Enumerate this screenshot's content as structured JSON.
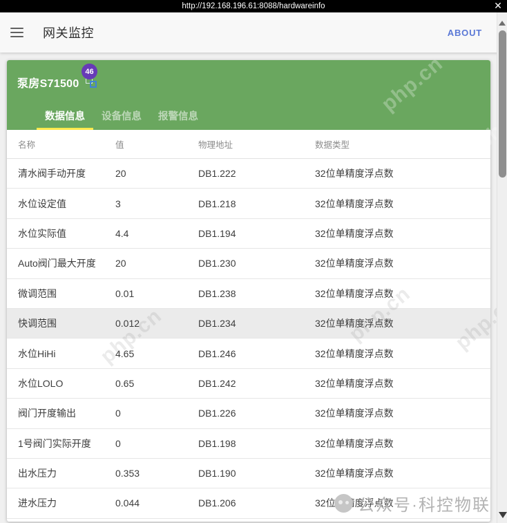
{
  "url_bar": {
    "url": "http://192.168.196.61:8088/hardwareinfo",
    "close_glyph": "✕"
  },
  "toolbar": {
    "title": "网关监控",
    "about_label": "ABOUT"
  },
  "panel": {
    "device_name": "泵房S71500",
    "badge_count": "46",
    "tabs": [
      {
        "label": "数据信息",
        "active": true
      },
      {
        "label": "设备信息",
        "active": false
      },
      {
        "label": "报警信息",
        "active": false
      }
    ]
  },
  "table": {
    "columns": [
      "名称",
      "值",
      "物理地址",
      "数据类型"
    ],
    "rows": [
      {
        "name": "清水阀手动开度",
        "value": "20",
        "address": "DB1.222",
        "type": "32位单精度浮点数",
        "highlighted": false
      },
      {
        "name": "水位设定值",
        "value": "3",
        "address": "DB1.218",
        "type": "32位单精度浮点数",
        "highlighted": false
      },
      {
        "name": "水位实际值",
        "value": "4.4",
        "address": "DB1.194",
        "type": "32位单精度浮点数",
        "highlighted": false
      },
      {
        "name": "Auto阀门最大开度",
        "value": "20",
        "address": "DB1.230",
        "type": "32位单精度浮点数",
        "highlighted": false
      },
      {
        "name": "微调范围",
        "value": "0.01",
        "address": "DB1.238",
        "type": "32位单精度浮点数",
        "highlighted": false
      },
      {
        "name": "快调范围",
        "value": "0.012",
        "address": "DB1.234",
        "type": "32位单精度浮点数",
        "highlighted": true
      },
      {
        "name": "水位HiHi",
        "value": "4.65",
        "address": "DB1.246",
        "type": "32位单精度浮点数",
        "highlighted": false
      },
      {
        "name": "水位LOLO",
        "value": "0.65",
        "address": "DB1.242",
        "type": "32位单精度浮点数",
        "highlighted": false
      },
      {
        "name": "阀门开度输出",
        "value": "0",
        "address": "DB1.226",
        "type": "32位单精度浮点数",
        "highlighted": false
      },
      {
        "name": "1号阀门实际开度",
        "value": "0",
        "address": "DB1.198",
        "type": "32位单精度浮点数",
        "highlighted": false
      },
      {
        "name": "出水压力",
        "value": "0.353",
        "address": "DB1.190",
        "type": "32位单精度浮点数",
        "highlighted": false
      },
      {
        "name": "进水压力",
        "value": "0.044",
        "address": "DB1.206",
        "type": "32位单精度浮点数",
        "highlighted": false
      }
    ]
  },
  "watermarks": {
    "site_text": "php.cn",
    "credit_text": "公众号·科控物联"
  },
  "colors": {
    "header_green": "#6aa75f",
    "badge_purple": "#673ab7",
    "tab_underline_yellow": "#ffe94d",
    "about_blue": "#5a78d6",
    "row_highlight": "#ebebeb",
    "url_bar_black": "#000000"
  }
}
